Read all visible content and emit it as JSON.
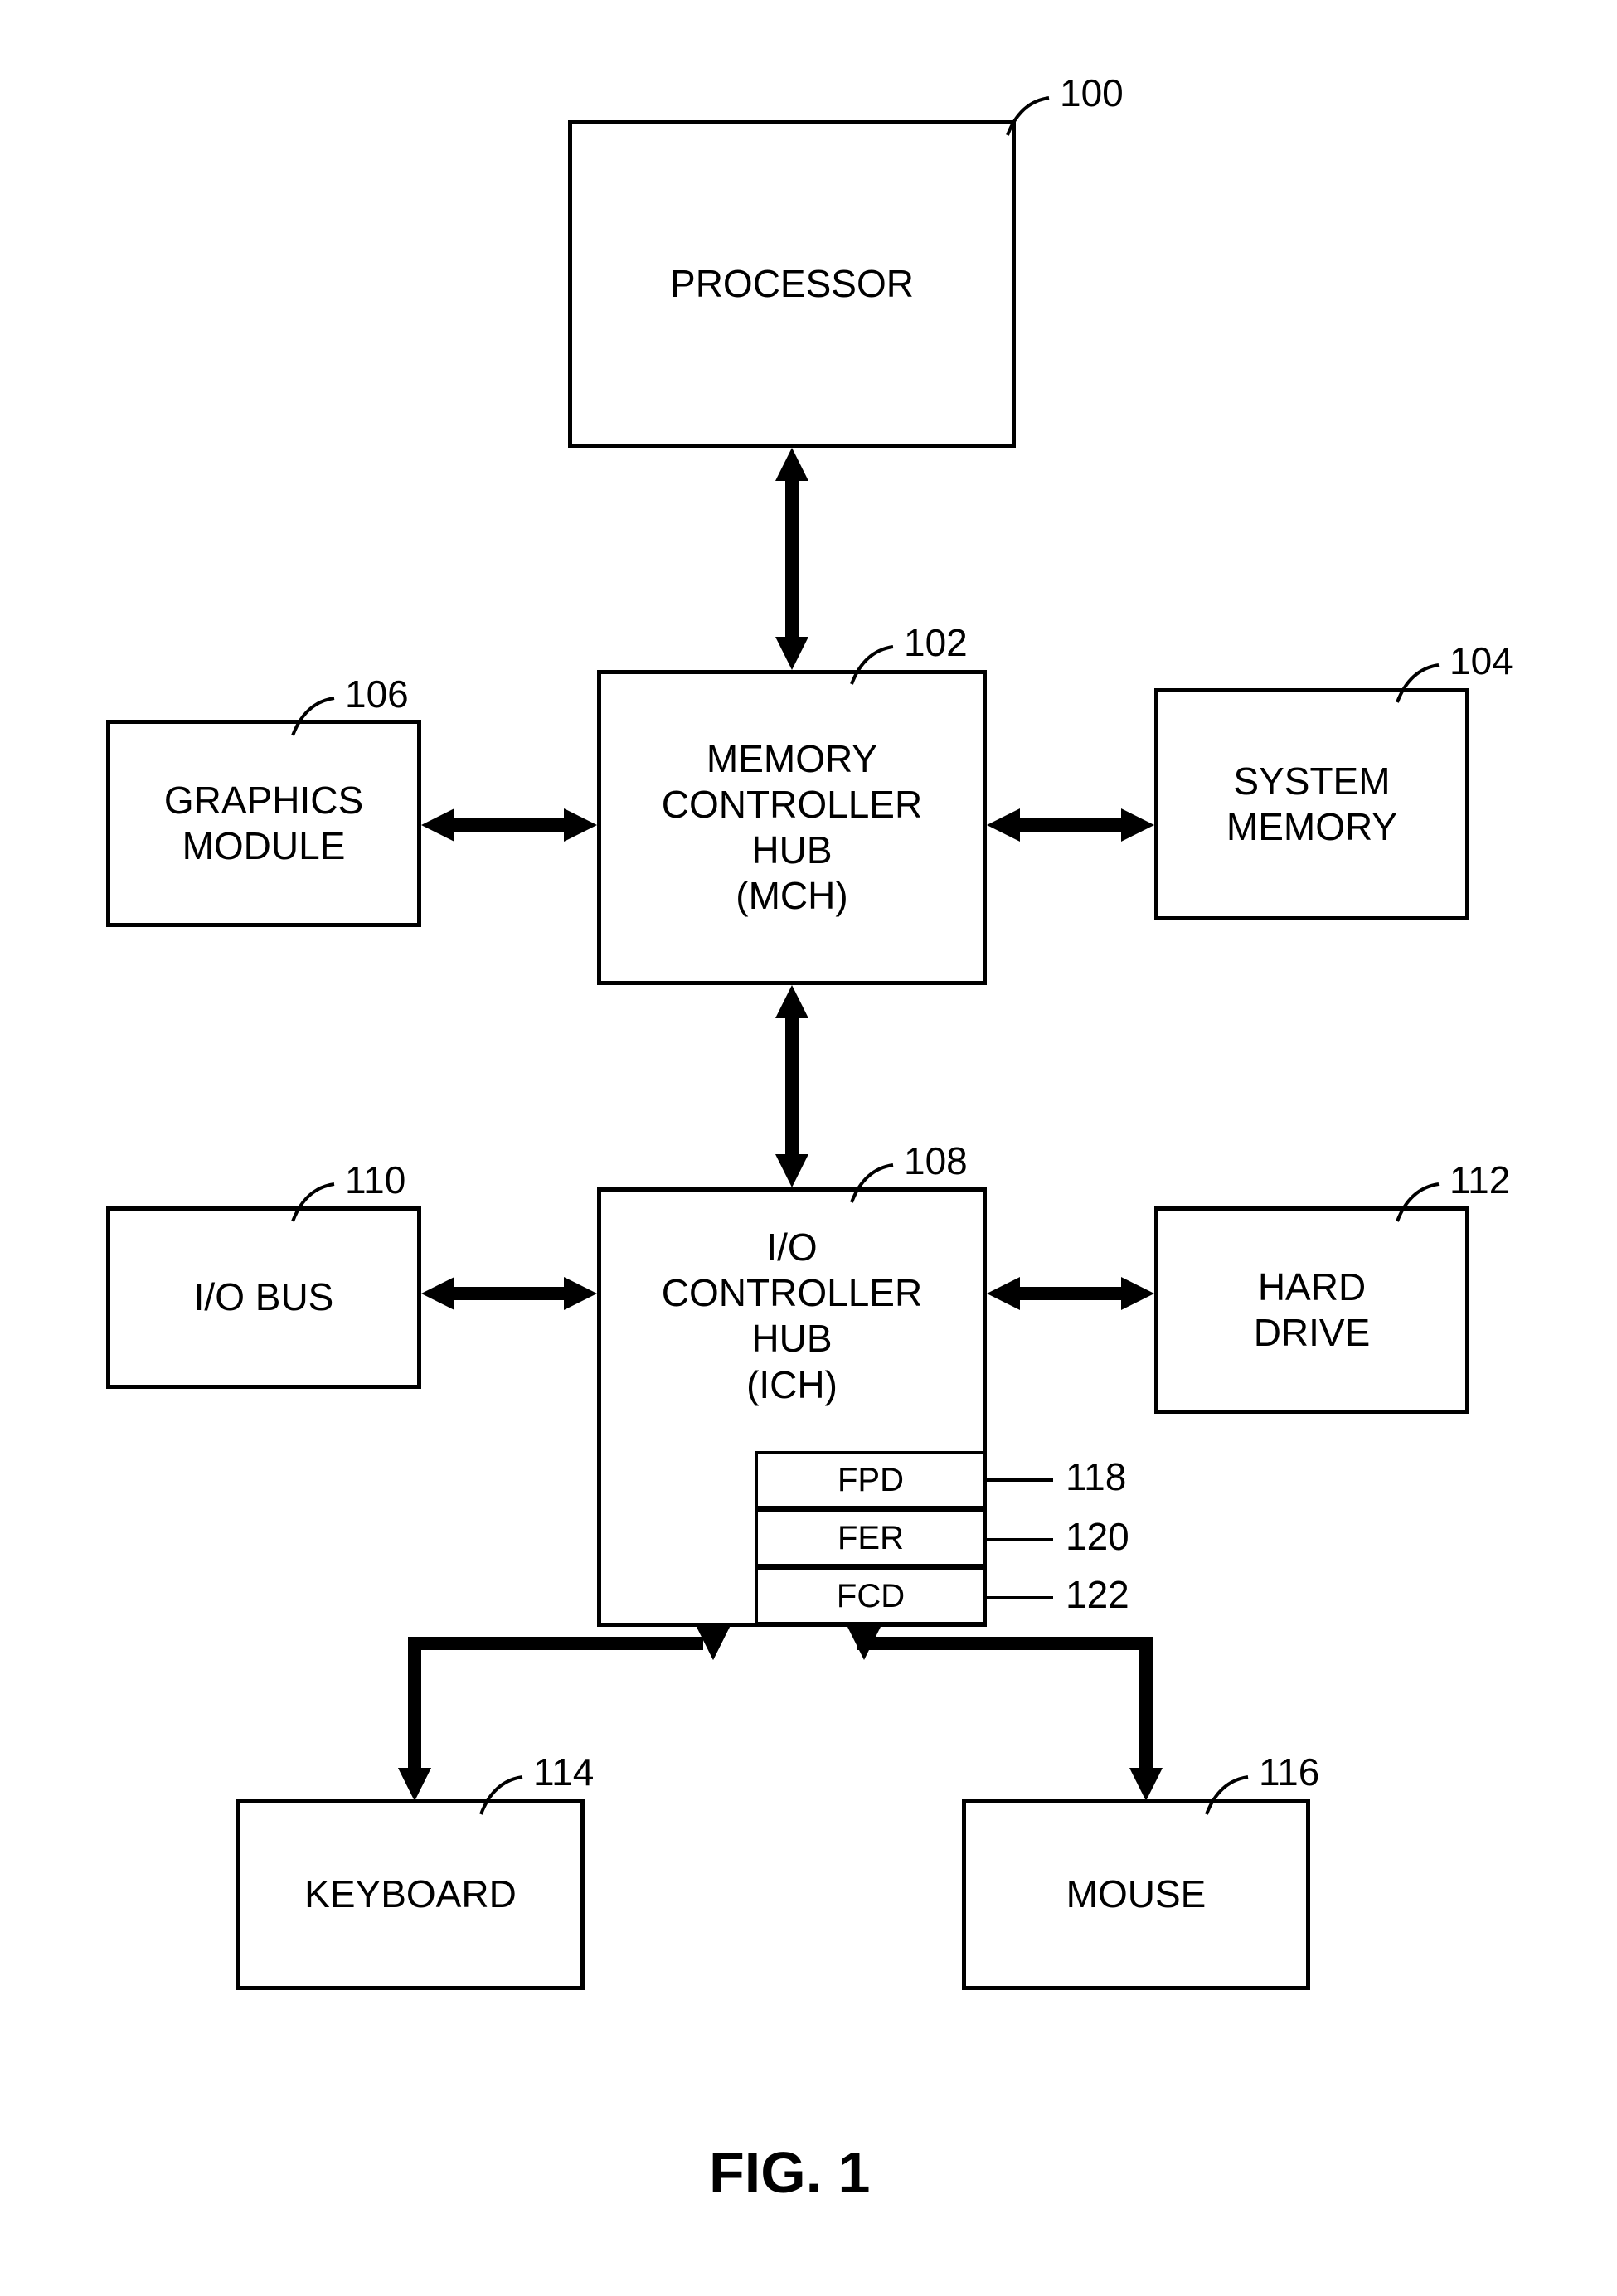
{
  "diagram": {
    "title": "FIG. 1",
    "blocks": {
      "processor": {
        "label": "PROCESSOR",
        "ref": "100"
      },
      "mch": {
        "label": "MEMORY\nCONTROLLER\nHUB\n(MCH)",
        "ref": "102"
      },
      "sysmem": {
        "label": "SYSTEM\nMEMORY",
        "ref": "104"
      },
      "graphics": {
        "label": "GRAPHICS\nMODULE",
        "ref": "106"
      },
      "ich": {
        "label": "I/O\nCONTROLLER\nHUB\n(ICH)",
        "ref": "108"
      },
      "iobus": {
        "label": "I/O BUS",
        "ref": "110"
      },
      "hdd": {
        "label": "HARD\nDRIVE",
        "ref": "112"
      },
      "keyboard": {
        "label": "KEYBOARD",
        "ref": "114"
      },
      "mouse": {
        "label": "MOUSE",
        "ref": "116"
      },
      "fpd": {
        "label": "FPD",
        "ref": "118"
      },
      "fer": {
        "label": "FER",
        "ref": "120"
      },
      "fcd": {
        "label": "FCD",
        "ref": "122"
      }
    }
  }
}
